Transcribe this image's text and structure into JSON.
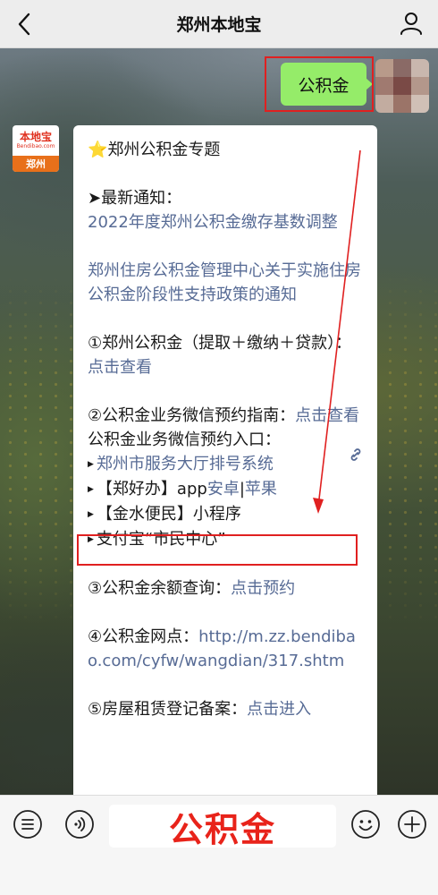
{
  "header": {
    "title": "郑州本地宝"
  },
  "outgoing": {
    "text": "公积金"
  },
  "bot": {
    "logo_cn": "本地宝",
    "logo_en": "Bendibao.com",
    "logo_city": "郑州"
  },
  "message": {
    "title": "⭐郑州公积金专题",
    "latest_label": "➤最新通知：",
    "notice1": "2022年度郑州公积金缴存基数调整",
    "notice2": "郑州住房公积金管理中心关于实施住房公积金阶段性支持政策的通知",
    "item1_text": "①郑州公积金（提取＋缴纳＋贷款）：",
    "item1_link": "点击查看",
    "item2_text": "②公积金业务微信预约指南：",
    "item2_link": "点击查看",
    "entry_label": "公积金业务微信预约入口：",
    "entry1_link": "郑州市服务大厅排号系统",
    "entry2_text": "【郑好办】app",
    "entry2_link_a": "安卓",
    "entry2_sep": "|",
    "entry2_link_b": "苹果",
    "entry3_text": "【金水便民】小程序",
    "entry4_text": "支付宝“市民中心”",
    "item3_text": "③公积金余额查询：",
    "item3_link": "点击预约",
    "item4_text": "④公积金网点：",
    "item4_link": "http://m.zz.bendibao.com/cyfw/wangdian/317.shtm",
    "item5_text": "⑤房屋租赁登记备案：",
    "item5_link": "点击进入"
  },
  "input": {
    "value": "公积金"
  },
  "colors": {
    "bubble_green": "#95ec69",
    "link": "#576b95",
    "highlight_red": "#e02020",
    "brand_orange": "#e8701a"
  },
  "icons": [
    "back-chevron-icon",
    "user-icon",
    "link-icon",
    "menu-list-icon",
    "voice-icon",
    "emoji-icon",
    "plus-icon"
  ]
}
